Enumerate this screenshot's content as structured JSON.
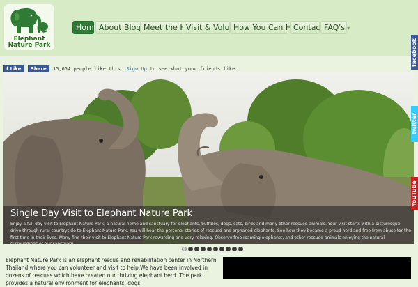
{
  "logo": {
    "line1": "Elephant",
    "line2": "Nature Park",
    "icon": "elephant-logo-icon"
  },
  "nav": {
    "items": [
      {
        "label": "Home",
        "active": true,
        "dropdown": false
      },
      {
        "label": "About",
        "active": false,
        "dropdown": true
      },
      {
        "label": "Blog",
        "active": false,
        "dropdown": false
      },
      {
        "label": "Meet the Herd",
        "active": false,
        "dropdown": false
      },
      {
        "label": "Visit & Volunteer",
        "active": false,
        "dropdown": false
      },
      {
        "label": "How You Can Help",
        "active": false,
        "dropdown": true
      },
      {
        "label": "Contact",
        "active": false,
        "dropdown": true
      },
      {
        "label": "FAQ's",
        "active": false,
        "dropdown": true
      }
    ]
  },
  "social": {
    "like_label": "Like",
    "share_label": "Share",
    "count_text": "15,654 people like this.",
    "signup_label": "Sign Up",
    "signup_suffix": "to see what your friends like."
  },
  "hero": {
    "title": "Single Day Visit to Elephant Nature Park",
    "text": "Enjoy a full day visit to Elephant Nature Park, a natural home and sanctuary for elephants, buffalos, dogs, cats, birds and many other rescued animals. Your visit starts with a picturesque drive through rural countryside to Elephant Nature Park. You will hear the personal stories of rescued and orphaned elephants. See how they became a proud herd and free from abuse for the first time in their lives. Many find their visit to Elephant Nature Park rewarding and very relaxing. Observe free roaming elephants, and other rescued animals enjoying the natural surroundings of our sanctuary.",
    "slide_count": 10,
    "active_slide": 1
  },
  "side_tabs": [
    {
      "label": "facebook",
      "color": "#3b5998"
    },
    {
      "label": "twitter",
      "color": "#33ccff"
    },
    {
      "label": "YouTube",
      "color": "#cc1f1f"
    }
  ],
  "intro": {
    "text": "Elephant Nature Park is an elephant rescue and rehabilitation center in Northern Thailand where you can volunteer and visit to help.We have been involved in dozens of rescues which have created our thriving elephant herd. The park provides a natural environment for elephants, dogs,"
  },
  "colors": {
    "header_bg": "#d6ebc6",
    "nav_active": "#2f7a35",
    "facebook": "#3b5998",
    "page_bg": "#e9f3df"
  }
}
